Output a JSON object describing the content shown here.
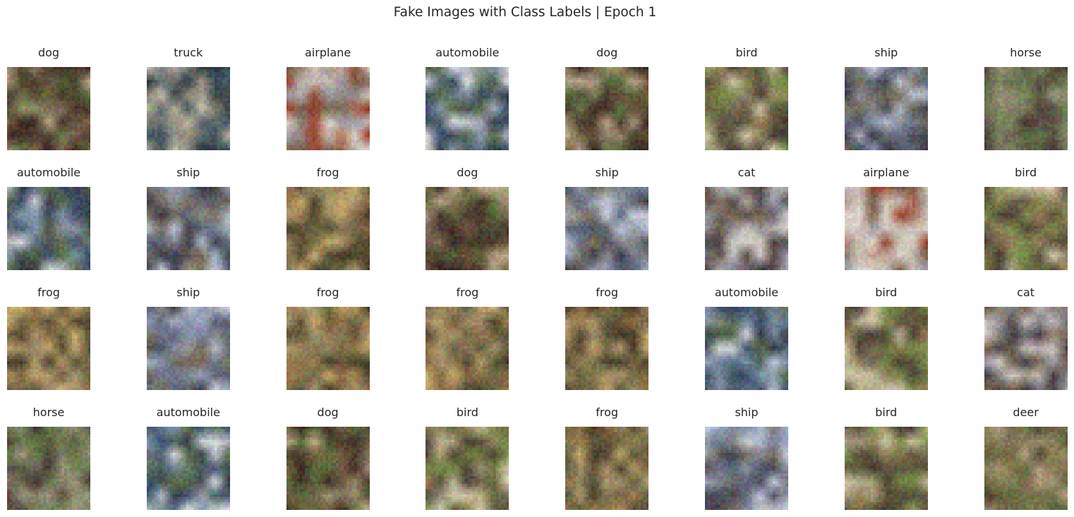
{
  "figure": {
    "title": "Fake Images with Class Labels | Epoch 1"
  },
  "grid": {
    "rows": 4,
    "cols": 8,
    "labels": [
      [
        "dog",
        "truck",
        "airplane",
        "automobile",
        "dog",
        "bird",
        "ship",
        "horse"
      ],
      [
        "automobile",
        "ship",
        "frog",
        "dog",
        "ship",
        "cat",
        "airplane",
        "bird"
      ],
      [
        "frog",
        "ship",
        "frog",
        "frog",
        "frog",
        "automobile",
        "bird",
        "cat"
      ],
      [
        "horse",
        "automobile",
        "dog",
        "bird",
        "frog",
        "ship",
        "bird",
        "deer"
      ]
    ]
  }
}
